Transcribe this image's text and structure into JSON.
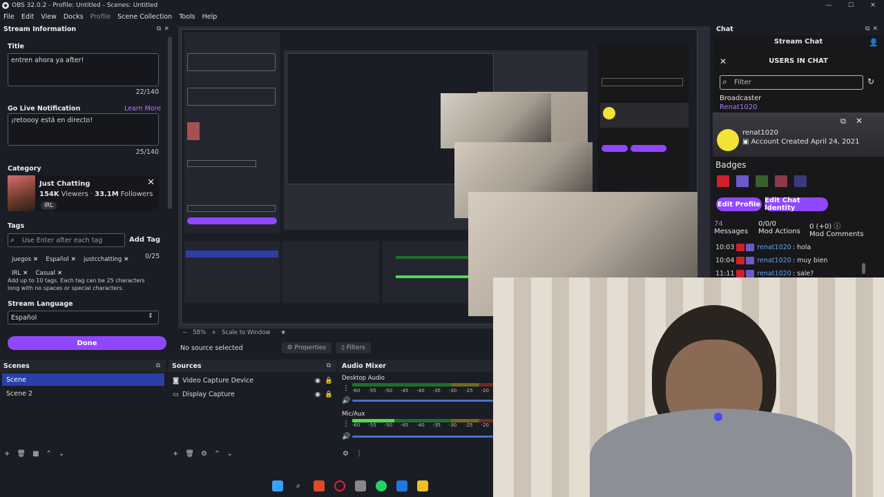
{
  "window": {
    "title": "OBS 32.0.2 - Profile: Untitled - Scenes: Untitled"
  },
  "menu": {
    "file": "File",
    "edit": "Edit",
    "view": "View",
    "docks": "Docks",
    "profile": "Profile",
    "scene_collection": "Scene Collection",
    "tools": "Tools",
    "help": "Help"
  },
  "stream_info": {
    "header": "Stream Information",
    "title_label": "Title",
    "title_value": "entren ahora ya after!",
    "title_count": "22/140",
    "notif_label": "Go Live Notification",
    "learn_more": "Learn More",
    "notif_value": "¡retoooy está en directo!",
    "notif_count": "25/140",
    "category_label": "Category",
    "category_name": "Just Chatting",
    "category_viewers": "154K",
    "viewers_word": "Viewers",
    "category_followers": "33.1M",
    "followers_word": "Followers",
    "category_tag": "IRL",
    "tags_label": "Tags",
    "tags_placeholder": "Use Enter after each tag",
    "add_tag": "Add Tag",
    "tags": [
      "juegos",
      "Español",
      "justcchatting",
      "IRL",
      "Casual"
    ],
    "tags_count": "0/25",
    "tags_help": "Add up to 10 tags. Each tag can be 25 characters long with no spaces or special characters.",
    "language_label": "Stream Language",
    "language_value": "Español",
    "done": "Done"
  },
  "preview_bar": {
    "zoom": "58%",
    "scale": "Scale to Window"
  },
  "source_bar": {
    "no_source": "No source selected",
    "properties": "Properties",
    "filters": "Filters"
  },
  "scenes": {
    "header": "Scenes",
    "items": [
      "Scene",
      "Scene 2"
    ]
  },
  "sources": {
    "header": "Sources",
    "items": [
      "Video Capture Device",
      "Display Capture"
    ]
  },
  "mixer": {
    "header": "Audio Mixer",
    "channels": [
      {
        "name": "Desktop Audio",
        "level": 0
      },
      {
        "name": "Mic/Aux",
        "level": 0.3
      }
    ],
    "ticks": [
      "-60",
      "-55",
      "-50",
      "-45",
      "-40",
      "-35",
      "-30",
      "-25",
      "-20"
    ]
  },
  "chat": {
    "header": "Chat",
    "stream_chat": "Stream Chat",
    "users_in_chat": "USERS IN CHAT",
    "filter_placeholder": "Filter",
    "broadcaster_label": "Broadcaster",
    "broadcaster_name": "Renat1020",
    "card_user": "renat1020",
    "card_created": "Account Created April 24, 2021",
    "badges_label": "Badges",
    "edit_profile": "Edit Profile",
    "edit_identity": "Edit Chat Identity",
    "stats": [
      {
        "value": "74",
        "label": "Messages"
      },
      {
        "value": "0/0/0",
        "label": "Mod Actions"
      },
      {
        "value": "0 (+0)",
        "label": "Mod Comments"
      }
    ],
    "messages": [
      {
        "time": "10:03",
        "user": "renat1020",
        "text": "hola"
      },
      {
        "time": "10:04",
        "user": "renat1020",
        "text": "muy bien"
      },
      {
        "time": "11:11",
        "user": "renat1020",
        "text": "sale?"
      }
    ]
  },
  "colors": {
    "accent": "#9147ff",
    "selection": "#2a3fa8",
    "link": "#a87bff",
    "chat_user": "#5aa7ff"
  }
}
